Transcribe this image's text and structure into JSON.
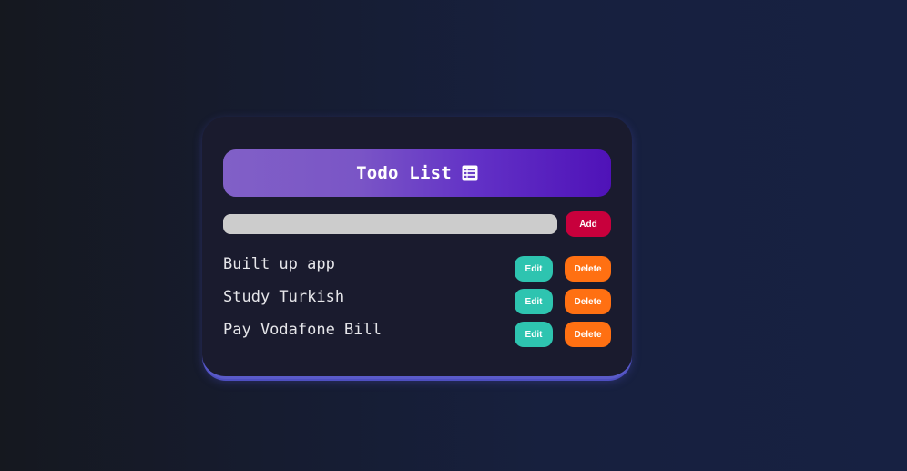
{
  "app": {
    "title": "Todo List",
    "icon": "list-icon"
  },
  "input": {
    "value": "",
    "placeholder": "",
    "add_label": "Add"
  },
  "todos": [
    {
      "text": "Built up app",
      "edit_label": "Edit",
      "delete_label": "Delete"
    },
    {
      "text": "Study Turkish",
      "edit_label": "Edit",
      "delete_label": "Delete"
    },
    {
      "text": "Pay Vodafone Bill",
      "edit_label": "Edit",
      "delete_label": "Delete"
    }
  ],
  "colors": {
    "header_start": "#8160c7",
    "header_end": "#4f12b8",
    "add_button": "#c8003c",
    "edit_button": "#2ec4b0",
    "delete_button": "#ff7012",
    "card_background": "#1a1b2e",
    "card_border": "#5a5bc9"
  }
}
